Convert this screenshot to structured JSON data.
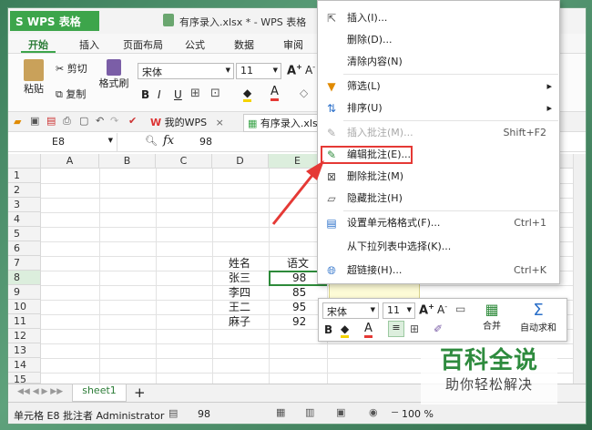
{
  "app": {
    "name": "WPS 表格",
    "doc_title": "有序录入.xlsx * - WPS 表格",
    "logo_letter": "S"
  },
  "ribbon_tabs": [
    "开始",
    "插入",
    "页面布局",
    "公式",
    "数据",
    "审阅"
  ],
  "ribbon": {
    "paste": "粘贴",
    "cut": "剪切",
    "copy": "复制",
    "format_painter": "格式刷",
    "font_name": "宋体",
    "font_size": "11",
    "bold": "B",
    "italic": "I",
    "underline": "U"
  },
  "quick_tabs": [
    {
      "label": "我的WPS",
      "close": "×"
    },
    {
      "label": "有序录入.xlsx"
    }
  ],
  "formula_bar": {
    "cell_ref": "E8",
    "fx": "fx",
    "value": "98"
  },
  "columns": [
    "A",
    "B",
    "C",
    "D",
    "E"
  ],
  "rows": [
    "1",
    "2",
    "3",
    "4",
    "5",
    "6",
    "7",
    "8",
    "9",
    "10",
    "11",
    "12",
    "13",
    "14",
    "15"
  ],
  "table": {
    "header": [
      "姓名",
      "语文"
    ],
    "records": [
      [
        "张三",
        "98"
      ],
      [
        "李四",
        "85"
      ],
      [
        "王二",
        "95"
      ],
      [
        "麻子",
        "92"
      ]
    ]
  },
  "context_menu": {
    "items": [
      {
        "label": "插入(I)...",
        "icon": "insert-icon",
        "enabled": true
      },
      {
        "label": "删除(D)...",
        "enabled": true
      },
      {
        "label": "清除内容(N)",
        "enabled": true
      },
      {
        "sep": true
      },
      {
        "label": "筛选(L)",
        "icon": "filter-icon",
        "submenu": true,
        "enabled": true
      },
      {
        "label": "排序(U)",
        "icon": "sort-icon",
        "submenu": true,
        "enabled": true
      },
      {
        "sep": true
      },
      {
        "label": "插入批注(M)...",
        "icon": "insert-comment-icon",
        "shortcut": "Shift+F2",
        "enabled": false
      },
      {
        "label": "编辑批注(E)...",
        "icon": "edit-comment-icon",
        "enabled": true,
        "highlighted": true
      },
      {
        "label": "删除批注(M)",
        "icon": "delete-comment-icon",
        "enabled": true
      },
      {
        "label": "隐藏批注(H)",
        "icon": "hide-comment-icon",
        "enabled": true
      },
      {
        "sep": true
      },
      {
        "label": "设置单元格格式(F)...",
        "icon": "format-cells-icon",
        "shortcut": "Ctrl+1",
        "enabled": true
      },
      {
        "label": "从下拉列表中选择(K)...",
        "enabled": true
      },
      {
        "label": "超链接(H)...",
        "icon": "hyperlink-icon",
        "shortcut": "Ctrl+K",
        "enabled": true
      }
    ]
  },
  "mini_toolbar": {
    "font_name": "宋体",
    "font_size": "11",
    "bold": "B",
    "merge": "合并",
    "autosum": "自动求和"
  },
  "sheet_tab": "sheet1",
  "status": {
    "text": "单元格 E8 批注者 Administrator",
    "value": "98",
    "zoom": "100 %"
  },
  "watermark": {
    "line1": "百科全说",
    "line2": "助你轻松解决"
  },
  "colors": {
    "accent": "#3da54b",
    "highlight_border": "#e53935",
    "selection": "#2d8a3a"
  }
}
